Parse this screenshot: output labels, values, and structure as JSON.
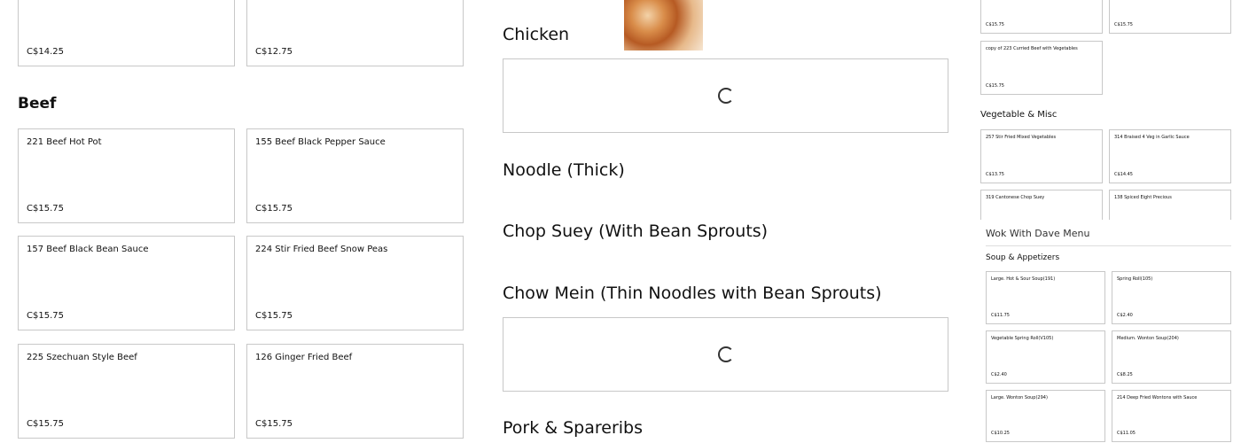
{
  "left": {
    "top_cards": [
      {
        "price": "C$14.25"
      },
      {
        "price": "C$12.75"
      }
    ],
    "beef_heading": "Beef",
    "beef_items": [
      {
        "name": "221 Beef Hot Pot",
        "price": "C$15.75"
      },
      {
        "name": "155 Beef Black Pepper Sauce",
        "price": "C$15.75"
      },
      {
        "name": "157 Beef Black Bean Sauce",
        "price": "C$15.75"
      },
      {
        "name": "224 Stir Fried Beef Snow Peas",
        "price": "C$15.75"
      },
      {
        "name": "225 Szechuan Style Beef",
        "price": "C$15.75"
      },
      {
        "name": "126 Ginger Fried Beef",
        "price": "C$15.75"
      }
    ]
  },
  "middle": {
    "categories": [
      "Chicken",
      "Noodle (Thick)",
      "Chop Suey (With Bean Sprouts)",
      "Chow Mein (Thin Noodles with Bean Sprouts)",
      "Pork & Spareribs"
    ]
  },
  "right_top": {
    "cards": [
      {
        "name": "",
        "price": "C$15.75"
      },
      {
        "name": "",
        "price": "C$15.75"
      },
      {
        "name": "copy of 223 Curried Beef with Vegetables",
        "price": "C$15.75"
      }
    ],
    "veg_heading": "Vegetable & Misc",
    "veg_items": [
      {
        "name": "257 Stir Fried Mixed Vegetables",
        "price": "C$13.75"
      },
      {
        "name": "314 Braised 4 Veg in Garlic Sauce",
        "price": "C$14.45"
      },
      {
        "name": "319 Cantonese Chop Suey",
        "price": ""
      },
      {
        "name": "138 Spiced Eight Precious",
        "price": ""
      }
    ]
  },
  "right_bottom": {
    "menu_title": "Wok With Dave Menu",
    "section": "Soup & Appetizers",
    "items": [
      {
        "name": "Large. Hot & Sour Soup(191)",
        "price": "C$11.75"
      },
      {
        "name": "Spring Roll(105)",
        "price": "C$2.40"
      },
      {
        "name": "Vegetable Spring Roll(V105)",
        "price": "C$2.40"
      },
      {
        "name": "Medium. Wonton Soup(204)",
        "price": "C$8.25"
      },
      {
        "name": "Large. Wonton Soup(294)",
        "price": "C$10.25"
      },
      {
        "name": "214 Deep Fried Wontons with Sauce",
        "price": "C$11.05"
      }
    ]
  }
}
